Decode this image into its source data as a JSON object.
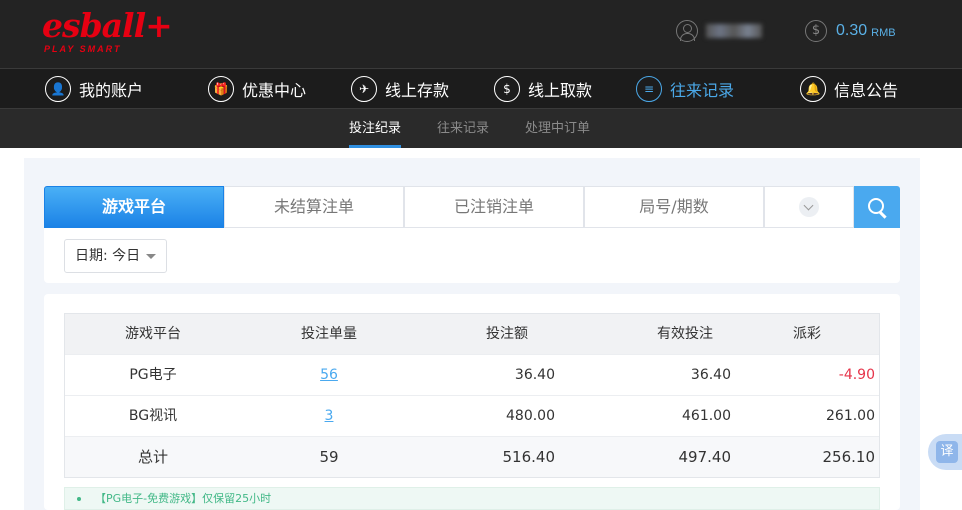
{
  "brand": {
    "logo_text": "esball+",
    "tagline": "PLAY SMART",
    "color": "#e60012"
  },
  "account": {
    "balance": "0.30",
    "currency": "RMB",
    "user_icon": "user-icon",
    "coin_icon": "dollar-coin-icon",
    "coin_glyph": "$"
  },
  "main_nav": [
    {
      "label": "我的账户",
      "icon": "user-icon",
      "glyph": "👤"
    },
    {
      "label": "优惠中心",
      "icon": "gift-icon",
      "glyph": "🎁"
    },
    {
      "label": "线上存款",
      "icon": "deposit-icon",
      "glyph": "✈"
    },
    {
      "label": "线上取款",
      "icon": "withdraw-icon",
      "glyph": "$"
    },
    {
      "label": "往来记录",
      "icon": "records-icon",
      "glyph": "≡",
      "active": true
    },
    {
      "label": "信息公告",
      "icon": "bell-icon",
      "glyph": "🔔"
    }
  ],
  "sub_nav": [
    {
      "label": "投注纪录",
      "active": true
    },
    {
      "label": "往来记录"
    },
    {
      "label": "处理中订单"
    }
  ],
  "filter_tabs": [
    {
      "label": "游戏平台",
      "active": true
    },
    {
      "label": "未结算注单"
    },
    {
      "label": "已注销注单"
    },
    {
      "label": "局号/期数"
    }
  ],
  "date_filter": {
    "label": "日期: 今日"
  },
  "table": {
    "headers": [
      "游戏平台",
      "投注单量",
      "投注额",
      "有效投注",
      "派彩"
    ],
    "rows": [
      {
        "platform": "PG电子",
        "count": "56",
        "bet": "36.40",
        "valid": "36.40",
        "payout": "-4.90"
      },
      {
        "platform": "BG视讯",
        "count": "3",
        "bet": "480.00",
        "valid": "461.00",
        "payout": "261.00"
      }
    ],
    "total": {
      "label": "总计",
      "count": "59",
      "bet": "516.40",
      "valid": "497.40",
      "payout": "256.10"
    }
  },
  "notice": "【PG电子-免费游戏】仅保留25小时",
  "translate_widget": {
    "label": "译"
  },
  "colors": {
    "accent": "#4aa9ef",
    "negative": "#e6344a",
    "notice_green": "#42b887"
  }
}
